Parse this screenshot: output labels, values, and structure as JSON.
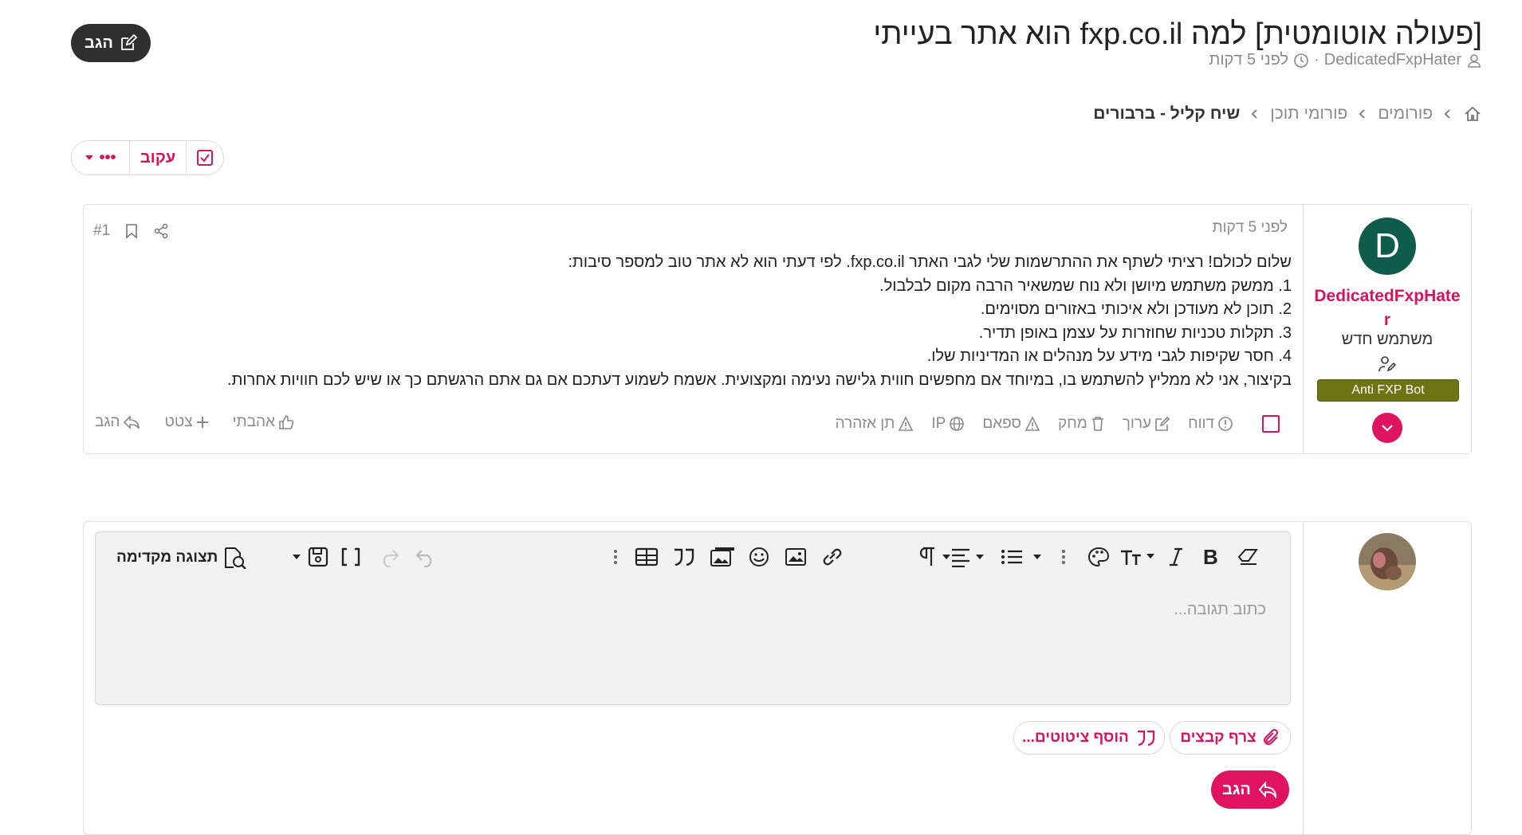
{
  "thread": {
    "title": "[פעולה אוטומטית] למה fxp.co.il הוא אתר בעייתי",
    "author": "DedicatedFxpHater",
    "time": "לפני 5 דקות",
    "reply_button": "הגב"
  },
  "breadcrumb": {
    "items": [
      "פורומים",
      "פורומי תוכן",
      "שיח קליל - ברבורים"
    ]
  },
  "followbar": {
    "follow_label": "עקוב",
    "more_label": "•••"
  },
  "post": {
    "number": "#1",
    "time": "לפני 5 דקות",
    "author_line1": "DedicatedFxpHate",
    "author_line2": "r",
    "user_title": "משתמש חדש",
    "badge": "Anti FXP Bot",
    "lines": [
      "שלום לכולם! רציתי לשתף את ההתרשמות שלי לגבי האתר fxp.co.il. לפי דעתי הוא לא אתר טוב למספר סיבות:",
      "1. ממשק משתמש מיושן ולא נוח שמשאיר הרבה מקום לבלבול.",
      "2. תוכן לא מעודכן ולא איכותי באזורים מסוימים.",
      "3. תקלות טכניות שחוזרות על עצמן באופן תדיר.",
      "4. חסר שקיפות לגבי מידע על מנהלים או המדיניות שלו.",
      "בקיצור, אני לא ממליץ להשתמש בו, במיוחד אם מחפשים חווית גלישה נעימה ומקצועית. אשמח לשמוע דעתכם אם גם אתם הרגשתם כך או שיש לכם חוויות אחרות."
    ],
    "actions": {
      "report": "דווח",
      "edit": "ערוך",
      "delete": "מחק",
      "spam": "ספאם",
      "ip": "IP",
      "warn": "תן אזהרה"
    },
    "reactions": {
      "like": "אהבתי",
      "quote": "צטט",
      "reply": "הגב"
    }
  },
  "editor": {
    "placeholder": "כתוב תגובה...",
    "preview": "תצוגה מקדימה",
    "attach": "צרף קבצים",
    "add_quotes": "הוסף ציטוטים...",
    "send": "הגב"
  },
  "colors": {
    "accent": "#e0135e",
    "badge": "#6e7314",
    "avatar": "#0f5c4c"
  }
}
